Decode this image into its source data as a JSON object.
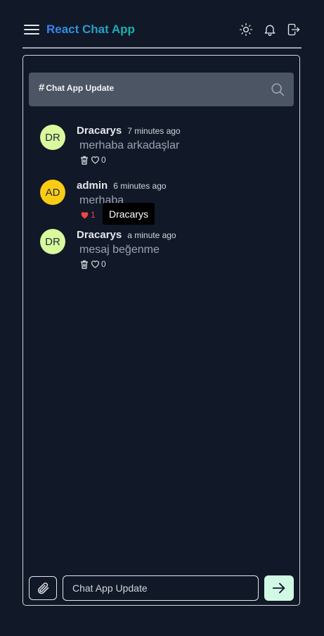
{
  "header": {
    "title": "React Chat App",
    "icons": [
      "menu-icon",
      "sun-icon",
      "bell-icon",
      "logout-icon"
    ]
  },
  "channel": {
    "name": "Chat App Update",
    "hash": "#"
  },
  "messages": [
    {
      "initials": "DR",
      "author": "Dracarys",
      "time": "7 minutes ago",
      "text": "merhaba arkadaşlar",
      "likes": "0",
      "liked": false,
      "avatar_color": "#d9f99d"
    },
    {
      "initials": "AD",
      "author": "admin",
      "time": "6 minutes ago",
      "text": "merhaba",
      "likes": "1",
      "liked": true,
      "avatar_color": "#facc15"
    },
    {
      "initials": "DR",
      "author": "Dracarys",
      "time": "a minute ago",
      "text": "mesaj beğenme",
      "likes": "0",
      "liked": false,
      "avatar_color": "#d9f99d"
    }
  ],
  "tooltip": {
    "text": "Dracarys"
  },
  "composer": {
    "placeholder": "Chat App Update"
  },
  "colors": {
    "background": "#111827",
    "channel_bar": "#4b5563",
    "send_button": "#d1fae5",
    "like_red": "#ef4444"
  }
}
